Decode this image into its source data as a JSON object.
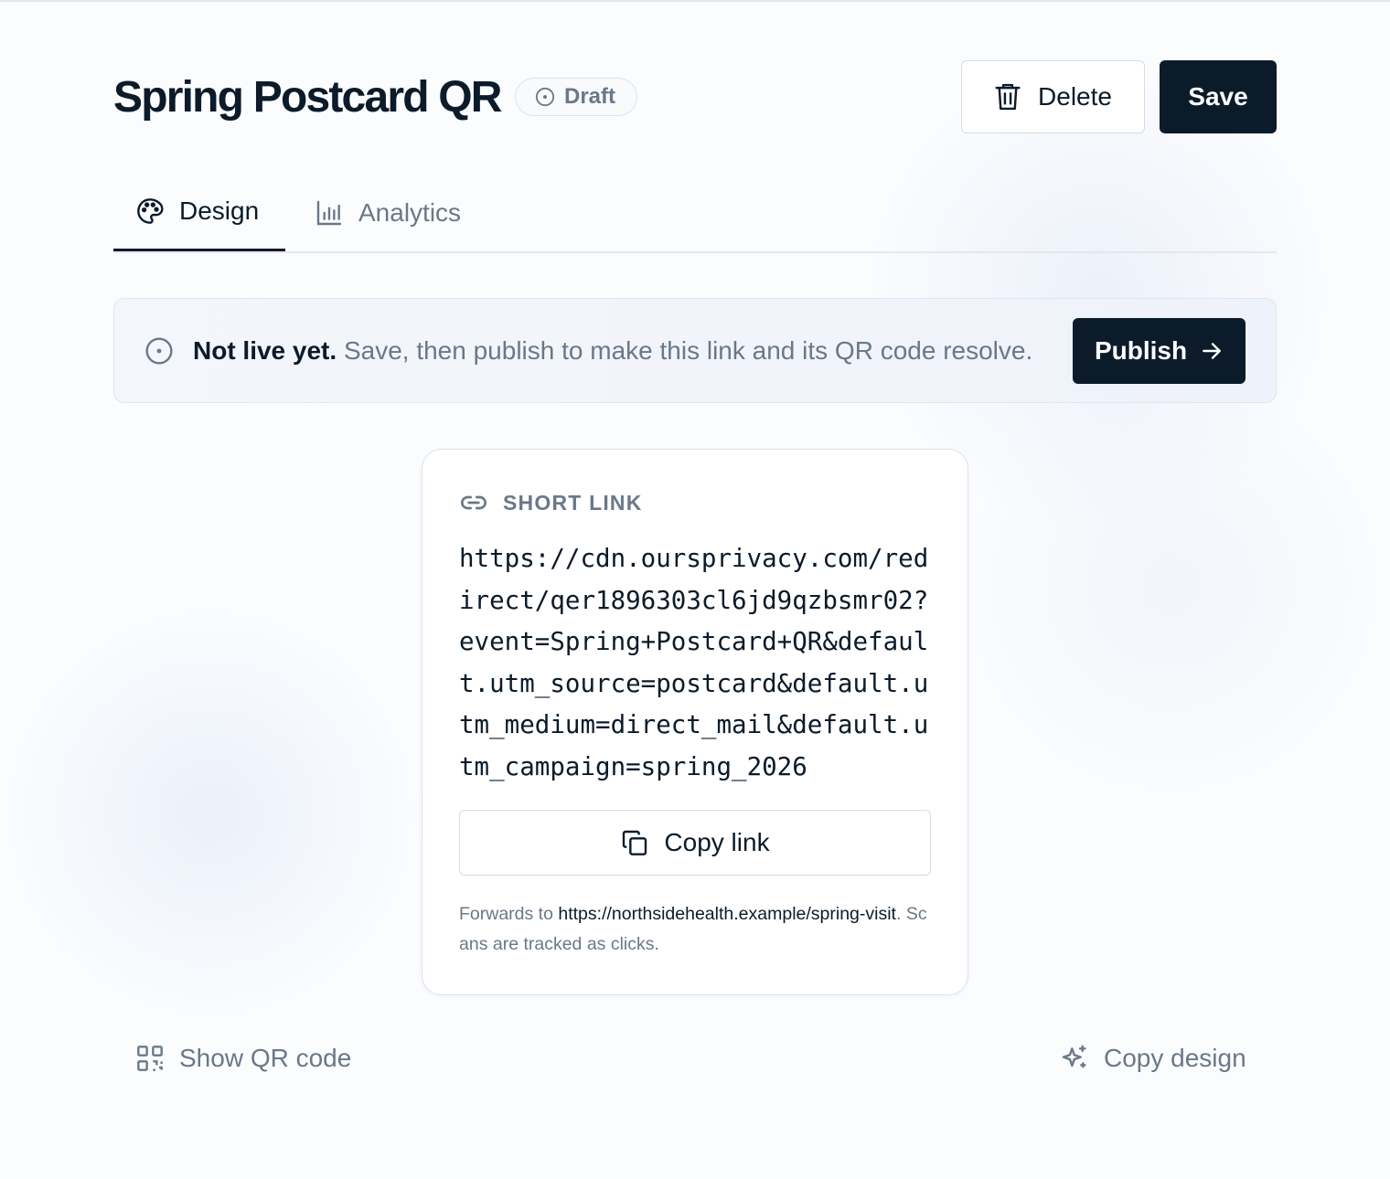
{
  "header": {
    "title": "Spring Postcard QR",
    "status": "Draft",
    "delete_label": "Delete",
    "save_label": "Save"
  },
  "tabs": [
    {
      "label": "Design",
      "icon": "palette-icon",
      "active": true
    },
    {
      "label": "Analytics",
      "icon": "bar-chart-icon",
      "active": false
    }
  ],
  "notice": {
    "icon": "dot-circle-icon",
    "strong": "Not live yet.",
    "text": " Save, then publish to make this link and its QR code resolve.",
    "publish_label": "Publish"
  },
  "short_link": {
    "label": "SHORT LINK",
    "icon": "link-icon",
    "url": "https://cdn.oursprivacy.com/redirect/qer1896303cl6jd9qzbsmr02?event=Spring+Postcard+QR&default.utm_source=postcard&default.utm_medium=direct_mail&default.utm_campaign=spring_2026",
    "copy_label": "Copy link",
    "forward_prefix": "Forwards to ",
    "forward_url": "https://northsidehealth.example/spring-visit",
    "forward_suffix": ". Scans are tracked as clicks."
  },
  "footer": {
    "show_qr_label": "Show QR code",
    "copy_design_label": "Copy design"
  },
  "colors": {
    "primary": "#0b1b2a",
    "muted": "#6a7888",
    "border": "#dde3ea",
    "background": "#fbfcfe"
  }
}
